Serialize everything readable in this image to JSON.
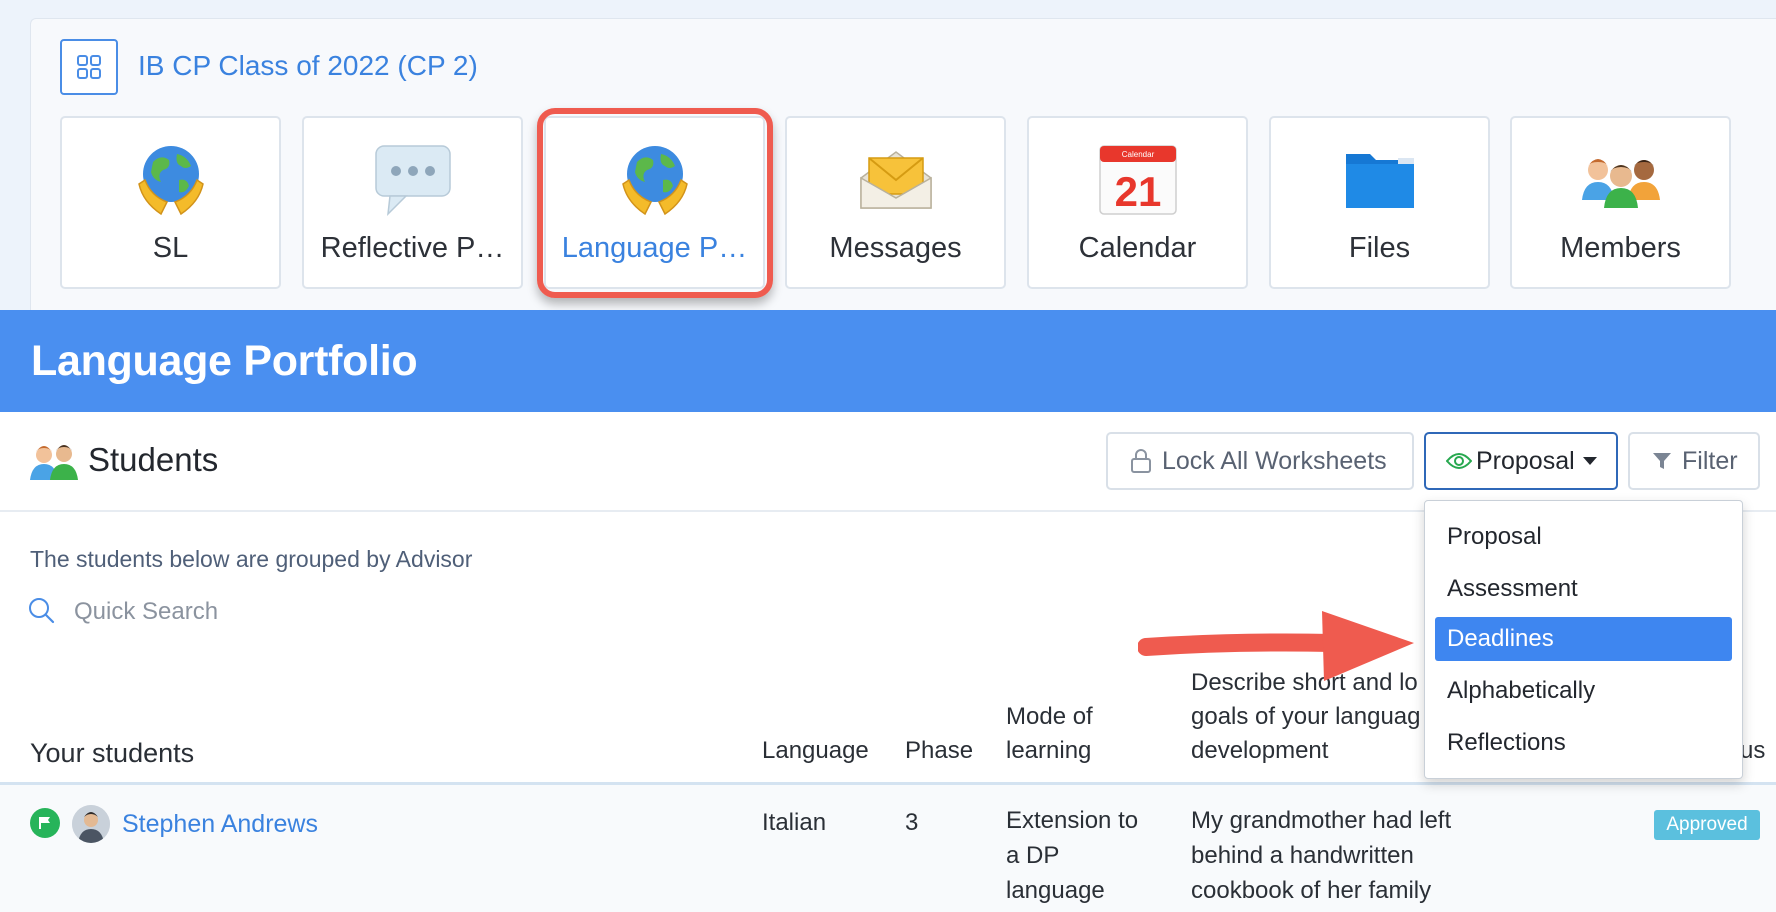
{
  "class": {
    "title": "IB CP Class of 2022 (CP 2)",
    "tiles": [
      {
        "label": "SL",
        "icon": "globe-hands-icon"
      },
      {
        "label": "Reflective P…",
        "icon": "speech-bubble-icon"
      },
      {
        "label": "Language P…",
        "icon": "globe-hands-icon",
        "active": true
      },
      {
        "label": "Messages",
        "icon": "envelope-icon"
      },
      {
        "label": "Calendar",
        "icon": "calendar-icon",
        "calendar_month": "Calendar",
        "calendar_day": "21"
      },
      {
        "label": "Files",
        "icon": "folder-icon"
      },
      {
        "label": "Members",
        "icon": "people-group-icon"
      }
    ]
  },
  "header": {
    "title": "Language Portfolio"
  },
  "students": {
    "title": "Students",
    "lock_label": "Lock All Worksheets",
    "view_label": "Proposal",
    "filter_label": "Filter",
    "grouped_text": "The students below are grouped by Advisor",
    "search_placeholder": "Quick Search"
  },
  "dropdown": {
    "items": [
      "Proposal",
      "Assessment",
      "Deadlines",
      "Alphabetically",
      "Reflections"
    ],
    "selected": "Deadlines"
  },
  "table": {
    "group_header": "Your students",
    "headers": {
      "language": "Language",
      "phase": "Phase",
      "mode": [
        "Mode of",
        "learning"
      ],
      "goals": [
        "Describe short and lo",
        "goals of your languag",
        "development"
      ],
      "status_fragment": "us"
    },
    "rows": [
      {
        "name": "Stephen Andrews",
        "language": "Italian",
        "phase": "3",
        "mode": [
          "Extension to",
          "a DP",
          "language"
        ],
        "goals": [
          "My grandmother had left",
          "behind a handwritten",
          "cookbook of her family"
        ],
        "status": "Approved"
      }
    ]
  },
  "colors": {
    "accent": "#3a82df",
    "header_bg": "#4a8ff0",
    "highlight": "#ef5b4f",
    "status_badge": "#5bc0de",
    "flag": "#27b45a"
  }
}
